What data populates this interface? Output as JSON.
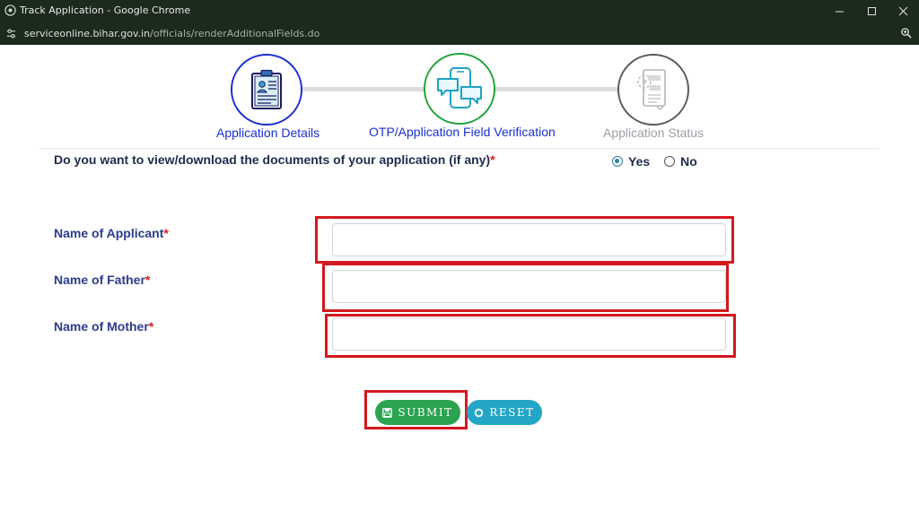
{
  "window": {
    "title": "Track Application - Google Chrome",
    "url_host": "serviceonline.bihar.gov.in",
    "url_path": "/officials/renderAdditionalFields.do"
  },
  "stepper": {
    "steps": [
      {
        "label": "Application Details",
        "icon": "application-form-icon",
        "color": "#1a2fd3"
      },
      {
        "label": "OTP/Application Field Verification",
        "icon": "chat-phone-icon",
        "color": "#1a2fd3"
      },
      {
        "label": "Application Status",
        "icon": "status-document-icon",
        "color": "#9aa0a6"
      }
    ]
  },
  "question": {
    "text": "Do you want to view/download the documents of your application (if any)",
    "required_mark": "*",
    "options": [
      {
        "label": "Yes",
        "selected": true
      },
      {
        "label": "No",
        "selected": false
      }
    ]
  },
  "form": {
    "fields": [
      {
        "label": "Name of Applicant",
        "required_mark": "*",
        "value": ""
      },
      {
        "label": "Name of Father",
        "required_mark": "*",
        "value": ""
      },
      {
        "label": "Name of Mother",
        "required_mark": "*",
        "value": ""
      }
    ],
    "submit_label": "SUBMIT",
    "reset_label": "RESET"
  },
  "colors": {
    "highlight": "#d4181f",
    "submit": "#2aa44f",
    "reset": "#23a5c7",
    "label": "#2a3c8d"
  }
}
